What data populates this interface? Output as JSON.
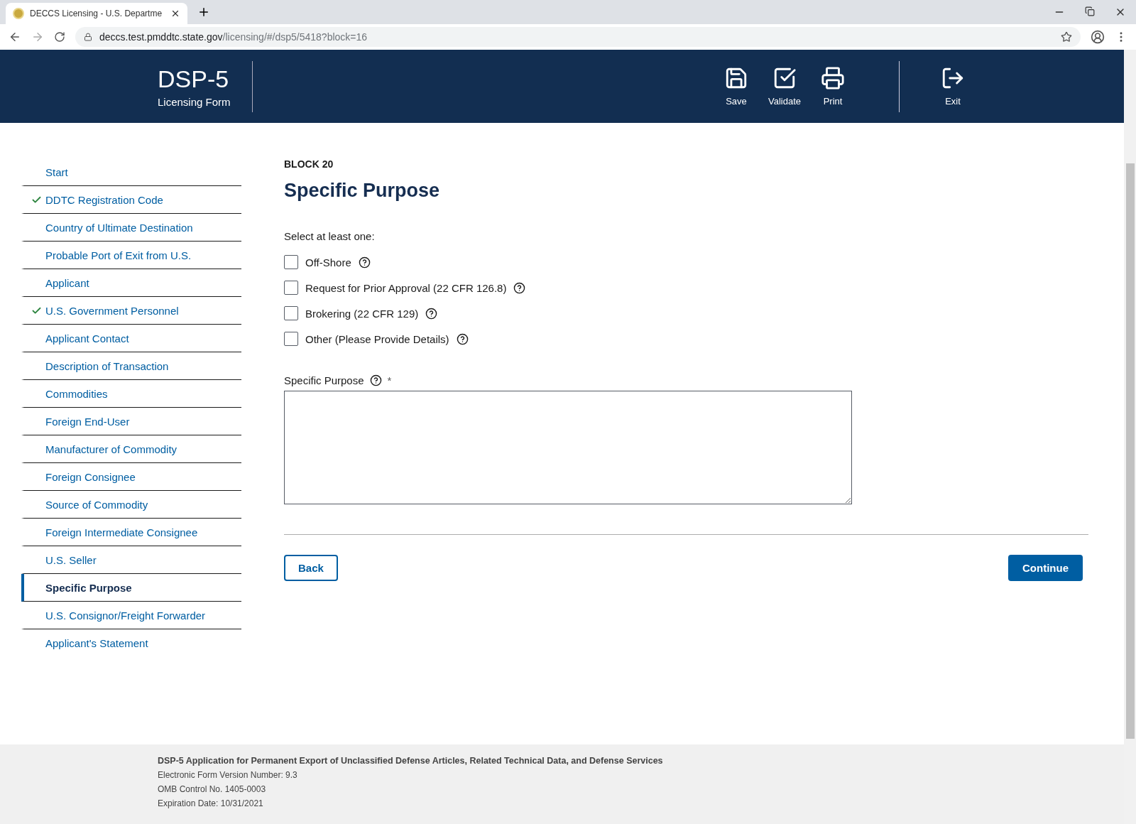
{
  "browser": {
    "tab_title": "DECCS Licensing - U.S. Departme",
    "url_host": "deccs.test.pmddtc.state.gov",
    "url_path": "/licensing/#/dsp5/5418?block=16"
  },
  "header": {
    "title": "DSP-5",
    "subtitle": "Licensing Form",
    "actions": [
      {
        "kind": "save",
        "label": "Save"
      },
      {
        "kind": "validate",
        "label": "Validate"
      },
      {
        "kind": "print",
        "label": "Print"
      },
      {
        "kind": "exit",
        "label": "Exit"
      }
    ]
  },
  "sidebar": {
    "items": [
      {
        "label": "Start",
        "completed": false,
        "selected": false
      },
      {
        "label": "DDTC Registration Code",
        "completed": true,
        "selected": false
      },
      {
        "label": "Country of Ultimate Destination",
        "completed": false,
        "selected": false
      },
      {
        "label": "Probable Port of Exit from U.S.",
        "completed": false,
        "selected": false
      },
      {
        "label": "Applicant",
        "completed": false,
        "selected": false
      },
      {
        "label": "U.S. Government Personnel",
        "completed": true,
        "selected": false
      },
      {
        "label": "Applicant Contact",
        "completed": false,
        "selected": false
      },
      {
        "label": "Description of Transaction",
        "completed": false,
        "selected": false
      },
      {
        "label": "Commodities",
        "completed": false,
        "selected": false
      },
      {
        "label": "Foreign End-User",
        "completed": false,
        "selected": false
      },
      {
        "label": "Manufacturer of Commodity",
        "completed": false,
        "selected": false
      },
      {
        "label": "Foreign Consignee",
        "completed": false,
        "selected": false
      },
      {
        "label": "Source of Commodity",
        "completed": false,
        "selected": false
      },
      {
        "label": "Foreign Intermediate Consignee",
        "completed": false,
        "selected": false
      },
      {
        "label": "U.S. Seller",
        "completed": false,
        "selected": false
      },
      {
        "label": "Specific Purpose",
        "completed": false,
        "selected": true
      },
      {
        "label": "U.S. Consignor/Freight Forwarder",
        "completed": false,
        "selected": false
      },
      {
        "label": "Applicant's Statement",
        "completed": false,
        "selected": false
      }
    ]
  },
  "main": {
    "block_label": "BLOCK 20",
    "heading": "Specific Purpose",
    "instruction": "Select at least one:",
    "options": [
      {
        "label": "Off-Shore",
        "checked": false
      },
      {
        "label": "Request for Prior Approval (22 CFR 126.8)",
        "checked": false
      },
      {
        "label": "Brokering (22 CFR 129)",
        "checked": false
      },
      {
        "label": "Other (Please Provide Details)",
        "checked": false
      }
    ],
    "textarea": {
      "label": "Specific Purpose",
      "required_mark": "*"
    },
    "back_button": "Back",
    "continue_button": "Continue"
  },
  "footer": {
    "title": "DSP-5 Application for Permanent Export of Unclassified Defense Articles, Related Technical Data, and Defense Services",
    "lines": [
      "Electronic Form Version Number: 9.3",
      "OMB Control No. 1405-0003",
      "Expiration Date: 10/31/2021"
    ]
  }
}
